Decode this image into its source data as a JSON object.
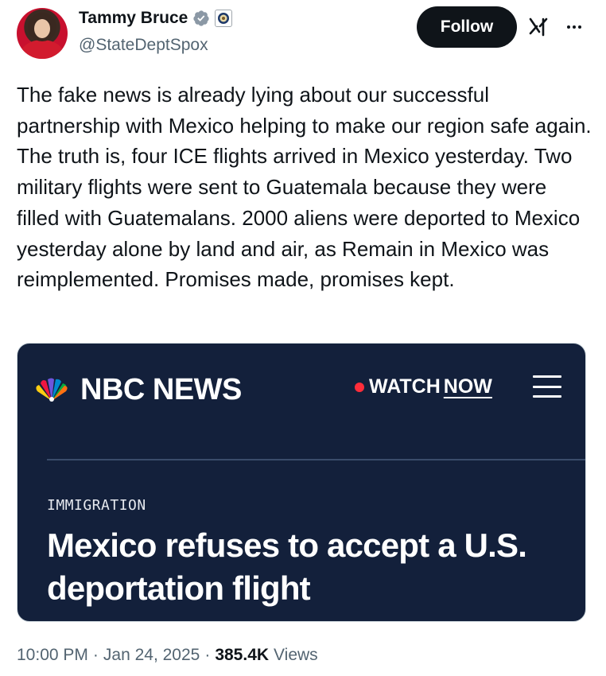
{
  "author": {
    "display_name": "Tammy Bruce",
    "handle": "@StateDeptSpox",
    "verified_icon": "verified-badge-icon",
    "affiliation_icon": "state-department-seal-icon"
  },
  "actions": {
    "follow_label": "Follow",
    "grok_icon": "grok-icon",
    "more_icon": "more-options-icon"
  },
  "tweet": {
    "text": "The fake news is already lying about our successful partnership with Mexico helping to make our region safe again. The truth is, four ICE flights arrived in Mexico yesterday. Two military flights were sent to Guatemala because they were filled with Guatemalans. 2000 aliens were deported to Mexico yesterday alone by land and air, as Remain in Mexico was reimplemented. Promises made, promises kept."
  },
  "card": {
    "brand": "NBC NEWS",
    "watch_label": "WATCH",
    "watch_now": "NOW",
    "category": "IMMIGRATION",
    "headline": "Mexico refuses to accept a U.S. deportation flight",
    "background_color": "#13203b"
  },
  "meta": {
    "time": "10:00 PM",
    "sep1": "·",
    "date": "Jan 24, 2025",
    "sep2": "·",
    "views_count": "385.4K",
    "views_label": "Views"
  },
  "colors": {
    "text_primary": "#0f1419",
    "text_secondary": "#536471",
    "verified_blue": "#1d9bf0",
    "live_red": "#ff2d3a"
  }
}
